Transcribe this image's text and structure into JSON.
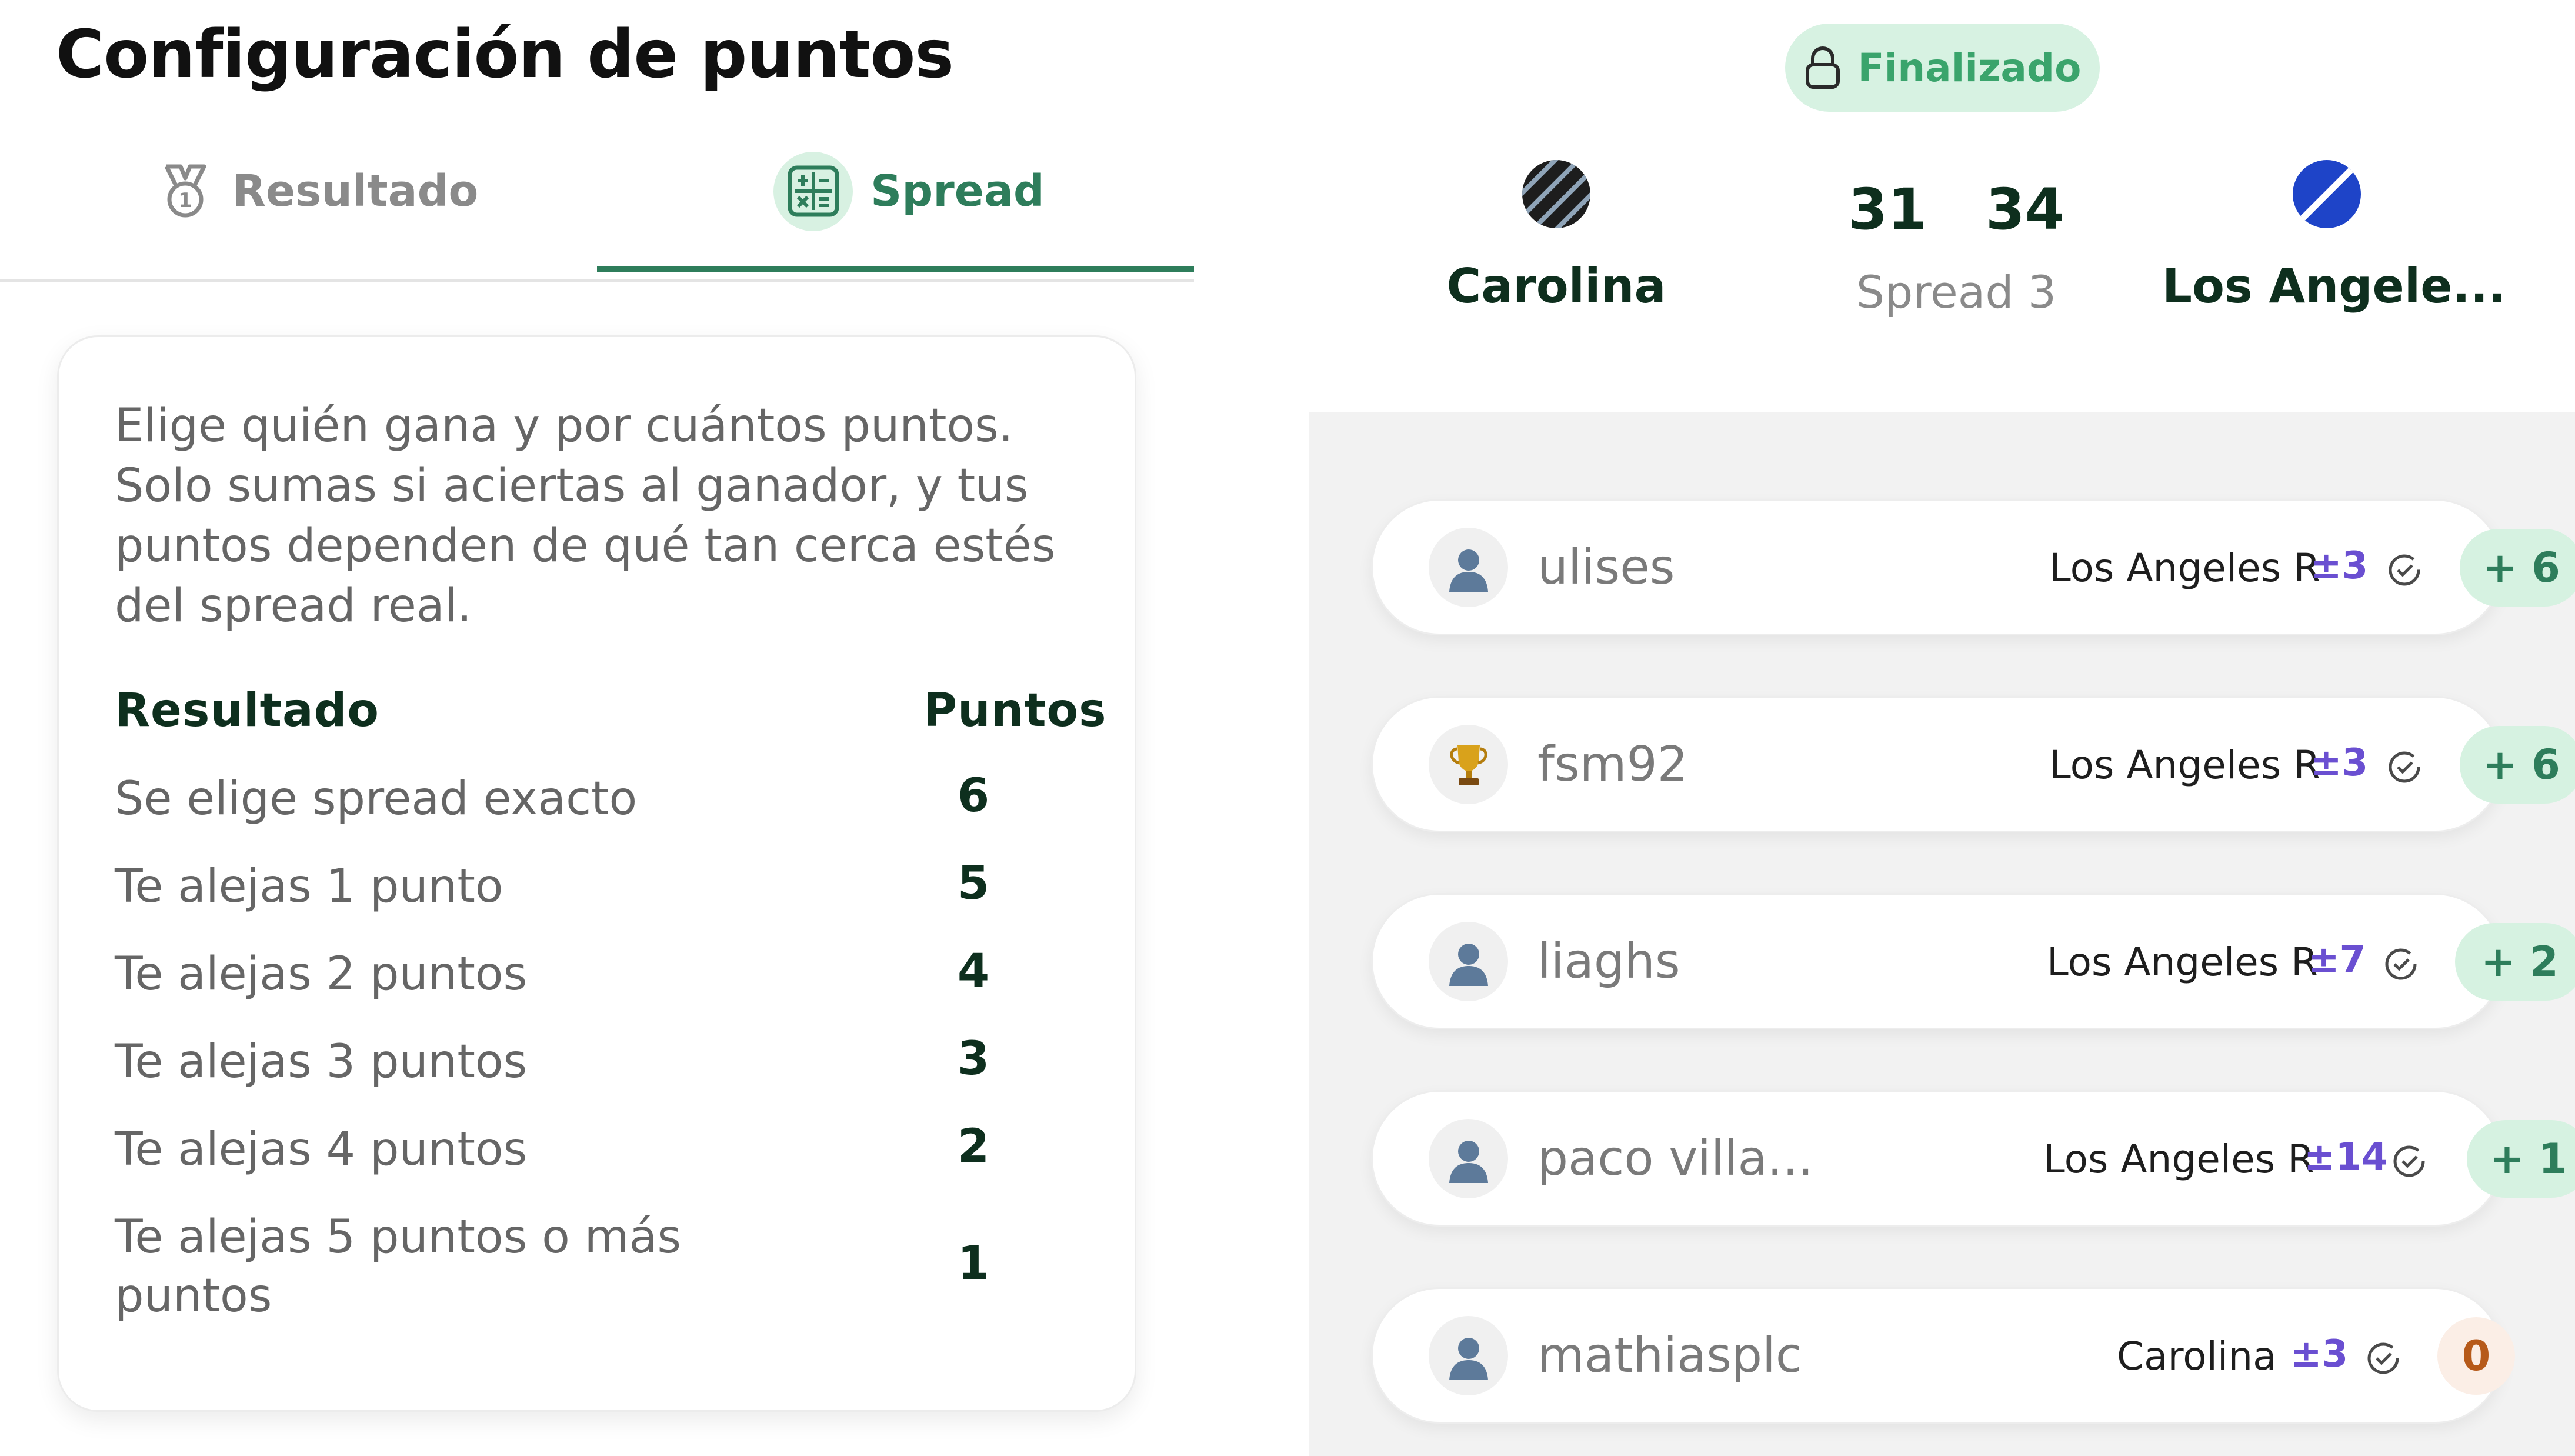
{
  "left": {
    "title": "Configuración de puntos",
    "tabs": [
      {
        "label": "Resultado",
        "icon": "medal-icon",
        "active": false
      },
      {
        "label": "Spread",
        "icon": "calculator-icon",
        "active": true
      }
    ],
    "card": {
      "description": "Elige quién gana y por cuántos puntos. Solo sumas si aciertas al ganador, y tus puntos dependen de qué tan cerca estés del spread real.",
      "header_result": "Resultado",
      "header_points": "Puntos",
      "rows": [
        {
          "label": "Se elige spread exacto",
          "points": "6"
        },
        {
          "label": "Te alejas 1 punto",
          "points": "5"
        },
        {
          "label": "Te alejas 2 puntos",
          "points": "4"
        },
        {
          "label": "Te alejas 3 puntos",
          "points": "3"
        },
        {
          "label": "Te alejas 4 puntos",
          "points": "2"
        },
        {
          "label": "Te alejas 5 puntos o más puntos",
          "points": "1"
        }
      ]
    }
  },
  "right": {
    "status": "Finalizado",
    "home_team": {
      "name": "Carolina",
      "logo": "striped-circle-logo"
    },
    "away_team": {
      "name": "Los Angele...",
      "logo": "blue-slash-circle-logo"
    },
    "home_score": "31",
    "away_score": "34",
    "spread_label": "Spread 3",
    "picks": [
      {
        "user": "ulises",
        "avatar": "user-avatar-icon",
        "team": "Los Angeles R",
        "spread": "±3",
        "points": "+ 6"
      },
      {
        "user": "fsm92",
        "avatar": "trophy-icon",
        "team": "Los Angeles R",
        "spread": "±3",
        "points": "+ 6"
      },
      {
        "user": "liaghs",
        "avatar": "user-avatar-icon",
        "team": "Los Angeles R",
        "spread": "±7",
        "points": "+ 2"
      },
      {
        "user": "paco villa...",
        "avatar": "user-avatar-icon",
        "team": "Los Angeles R",
        "spread": "±14",
        "points": "+ 1"
      },
      {
        "user": "mathiasplc",
        "avatar": "user-avatar-icon",
        "team": "Carolina",
        "spread": "±3",
        "points": "0"
      }
    ]
  },
  "colors": {
    "accent": "#2e7d5b",
    "pill_bg": "#d7f2e2",
    "spread_purple": "#6a4fd1",
    "zero_orange": "#b65a1a"
  }
}
